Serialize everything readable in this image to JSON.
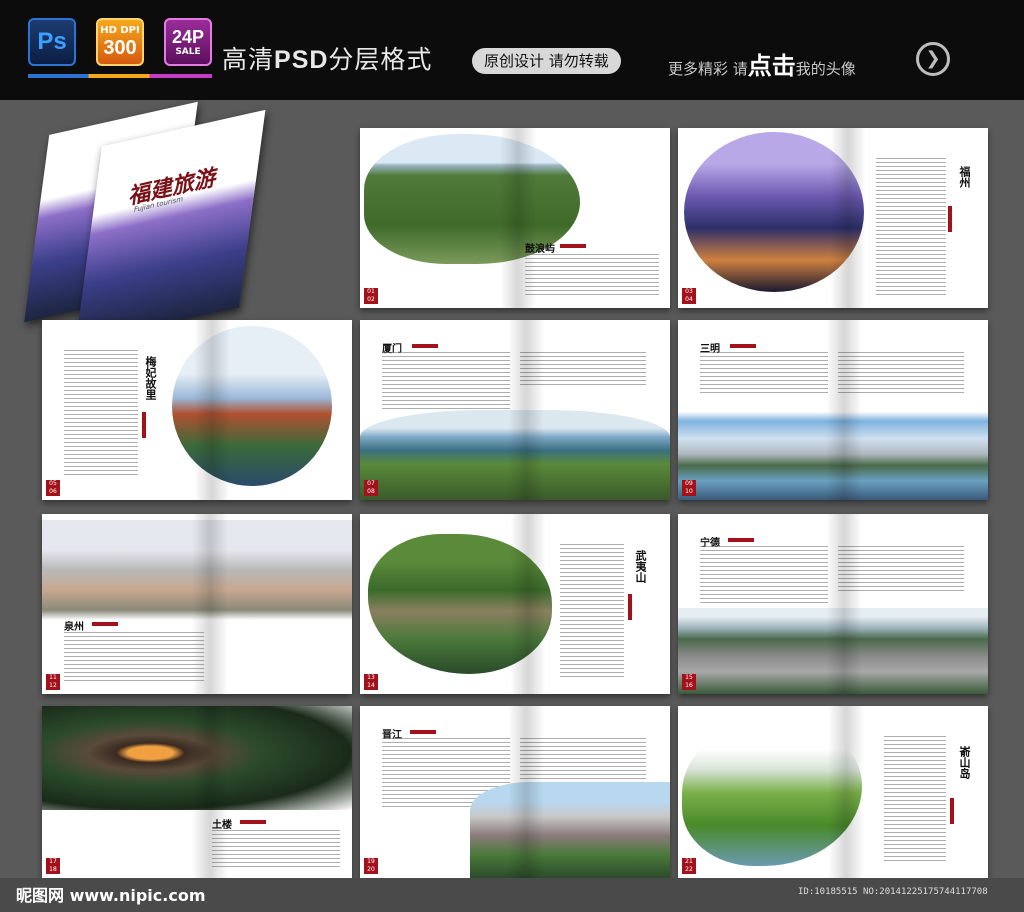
{
  "header": {
    "ps_badge": "Ps",
    "hd_badge_top": "HD DPI",
    "hd_badge_num": "300",
    "fps_badge_top": "24P",
    "fps_badge_bottom": "SALE",
    "title_prefix": "高清",
    "title_bold": "PSD",
    "title_suffix": "分层格式",
    "pill": "原创设计 请勿转载",
    "more_prefix": "更多精彩 请",
    "more_big": "点击",
    "more_suffix": "我的头像",
    "arrow_glyph": "❯"
  },
  "cover": {
    "title": "福建旅游",
    "subtitle": "Fujian tourism"
  },
  "spreads": [
    {
      "title": "鼓浪屿",
      "pages": "01 02"
    },
    {
      "title": "福州",
      "pages": "03 04"
    },
    {
      "title": "梅妃故里",
      "pages": "05 06"
    },
    {
      "title": "厦门",
      "pages": "07 08"
    },
    {
      "title": "三明",
      "pages": "09 10"
    },
    {
      "title": "泉州",
      "pages": "11 12"
    },
    {
      "title": "武夷山",
      "pages": "13 14"
    },
    {
      "title": "宁德",
      "pages": "15 16"
    },
    {
      "title": "土楼",
      "pages": "17 18"
    },
    {
      "title": "晋江",
      "pages": "19 20"
    },
    {
      "title": "嵛山岛",
      "pages": "21 22"
    }
  ],
  "footer": {
    "logo": "昵图网 www.nipic.com",
    "id": "ID:10185515 NO:20141225175744117708"
  },
  "colors": {
    "accent_red": "#a3111a",
    "background": "#5a5a5a",
    "topbar": "#0c0c0c"
  }
}
